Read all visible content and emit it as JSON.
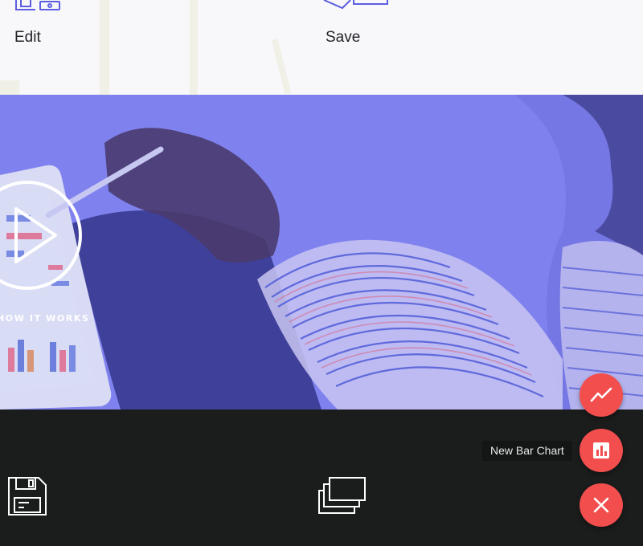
{
  "features": {
    "edit_label": "Edit",
    "save_label": "Save"
  },
  "hero": {
    "cta_label": "HOW IT WORKS",
    "overlay_color": "#7f82ee"
  },
  "footer": {
    "icons": [
      "floppy-disk-icon",
      "stacked-windows-icon"
    ]
  },
  "fab_menu": {
    "accent_color": "#f24e4e",
    "tooltip": "New Bar Chart",
    "actions": [
      "line-chart-icon",
      "bar-chart-icon",
      "close-icon"
    ]
  }
}
